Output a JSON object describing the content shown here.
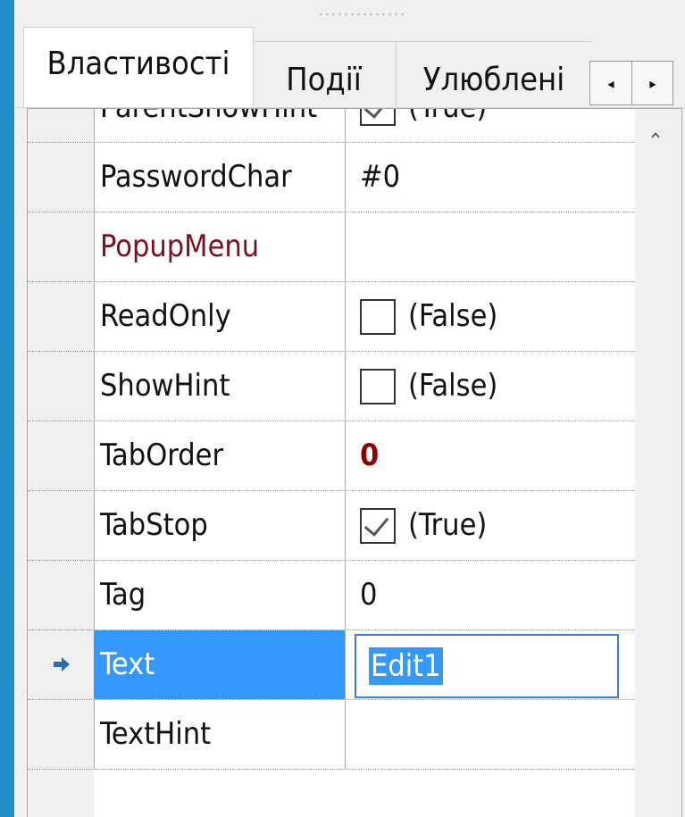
{
  "tabs": [
    {
      "label": "Властивості"
    },
    {
      "label": "Події"
    },
    {
      "label": "Улюблені"
    }
  ],
  "scroll": {
    "left_glyph": "◂",
    "right_glyph": "▸",
    "up_glyph": "⌃"
  },
  "rows": [
    {
      "name": "ParentShowHint",
      "value": "(True)"
    },
    {
      "name": "PasswordChar",
      "value": "#0"
    },
    {
      "name": "PopupMenu",
      "value": ""
    },
    {
      "name": "ReadOnly",
      "value": "(False)"
    },
    {
      "name": "ShowHint",
      "value": "(False)"
    },
    {
      "name": "TabOrder",
      "value": "0"
    },
    {
      "name": "TabStop",
      "value": "(True)"
    },
    {
      "name": "Tag",
      "value": "0"
    },
    {
      "name": "Text",
      "value": "Edit1"
    },
    {
      "name": "TextHint",
      "value": ""
    }
  ],
  "colors": {
    "selection": "#3399ff",
    "event_property": "#7a1020",
    "changed_value": "#8b0000"
  },
  "icons": {
    "row_marker": "right-arrow-icon",
    "scroll_up": "chevron-up-icon"
  }
}
